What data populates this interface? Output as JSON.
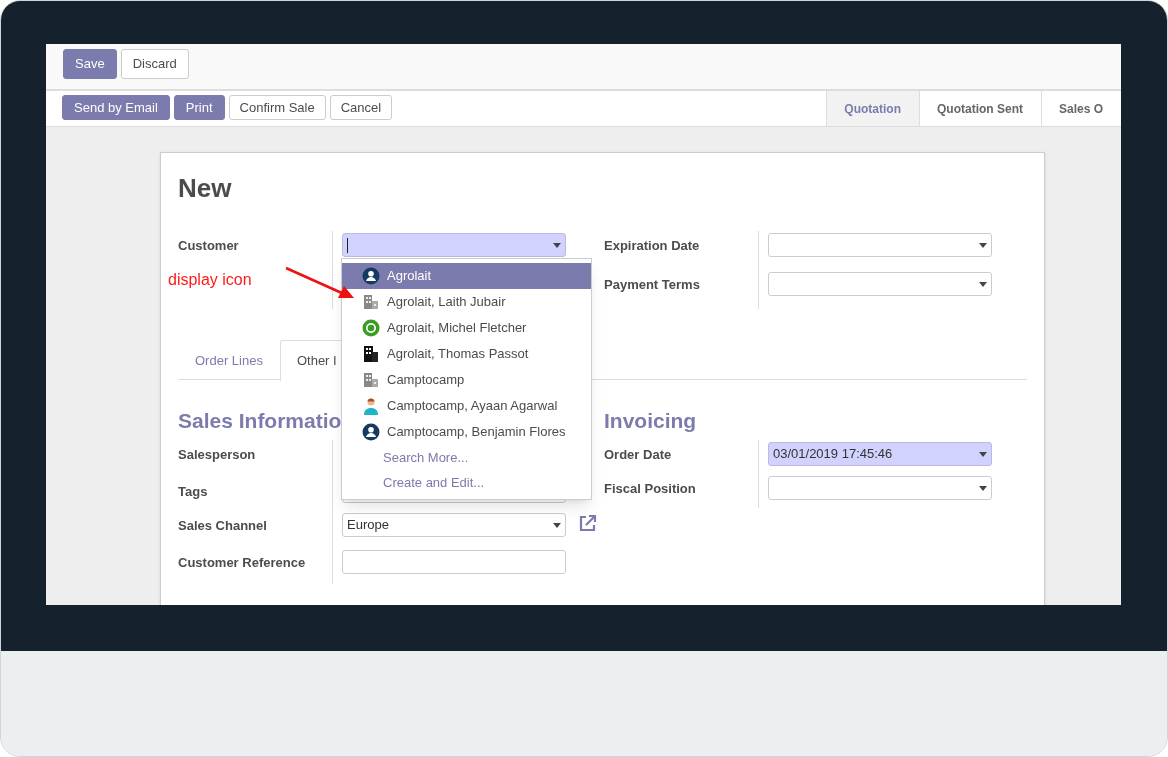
{
  "toolbar": {
    "buttons": [
      {
        "label": "Save",
        "kind": "primary"
      },
      {
        "label": "Discard",
        "kind": "secondary"
      }
    ]
  },
  "actions": {
    "buttons": [
      {
        "label": "Send by Email",
        "kind": "primary"
      },
      {
        "label": "Print",
        "kind": "primary"
      },
      {
        "label": "Confirm Sale",
        "kind": "secondary"
      },
      {
        "label": "Cancel",
        "kind": "secondary"
      }
    ]
  },
  "status_steps": [
    {
      "label": "Quotation",
      "selected": true
    },
    {
      "label": "Quotation Sent",
      "selected": false
    },
    {
      "label": "Sales O",
      "selected": false
    }
  ],
  "form": {
    "title": "New",
    "header_left": [
      {
        "label": "Customer",
        "kind": "select",
        "required": true,
        "focused": true
      }
    ],
    "header_right": [
      {
        "label": "Expiration Date",
        "kind": "select",
        "required": false
      },
      {
        "label": "Payment Terms",
        "kind": "select",
        "required": false
      }
    ],
    "tabs": [
      {
        "label": "Order Lines",
        "selected": false
      },
      {
        "label": "Other I",
        "selected": true
      }
    ],
    "left_section": {
      "title": "Sales Informatio",
      "fields": [
        {
          "label": "Salesperson"
        },
        {
          "label": "Tags",
          "kind": "select",
          "required": false
        },
        {
          "label": "Sales Channel",
          "value": "Europe",
          "kind": "select",
          "required": false,
          "link": true
        },
        {
          "label": "Customer Reference",
          "kind": "text",
          "required": false
        }
      ]
    },
    "right_section": {
      "title": "Invoicing",
      "fields": [
        {
          "label": "Order Date",
          "value": "03/01/2019 17:45:46",
          "kind": "select",
          "required": true
        },
        {
          "label": "Fiscal Position",
          "kind": "select",
          "required": false
        }
      ]
    }
  },
  "dropdown": {
    "items": [
      {
        "label": "Agrolait",
        "kind": "contact",
        "selected": true
      },
      {
        "label": "Agrolait, Laith Jubair",
        "kind": "company",
        "selected": false
      },
      {
        "label": "Agrolait, Michel Fletcher",
        "kind": "messenger",
        "selected": false
      },
      {
        "label": "Agrolait, Thomas Passot",
        "kind": "office",
        "selected": false
      },
      {
        "label": "Camptocamp",
        "kind": "company",
        "selected": false
      },
      {
        "label": "Camptocamp, Ayaan Agarwal",
        "kind": "person",
        "selected": false
      },
      {
        "label": "Camptocamp, Benjamin Flores",
        "kind": "contact",
        "selected": false
      }
    ],
    "links": [
      "Search More...",
      "Create and Edit..."
    ]
  },
  "annotation": {
    "text": "display icon"
  }
}
